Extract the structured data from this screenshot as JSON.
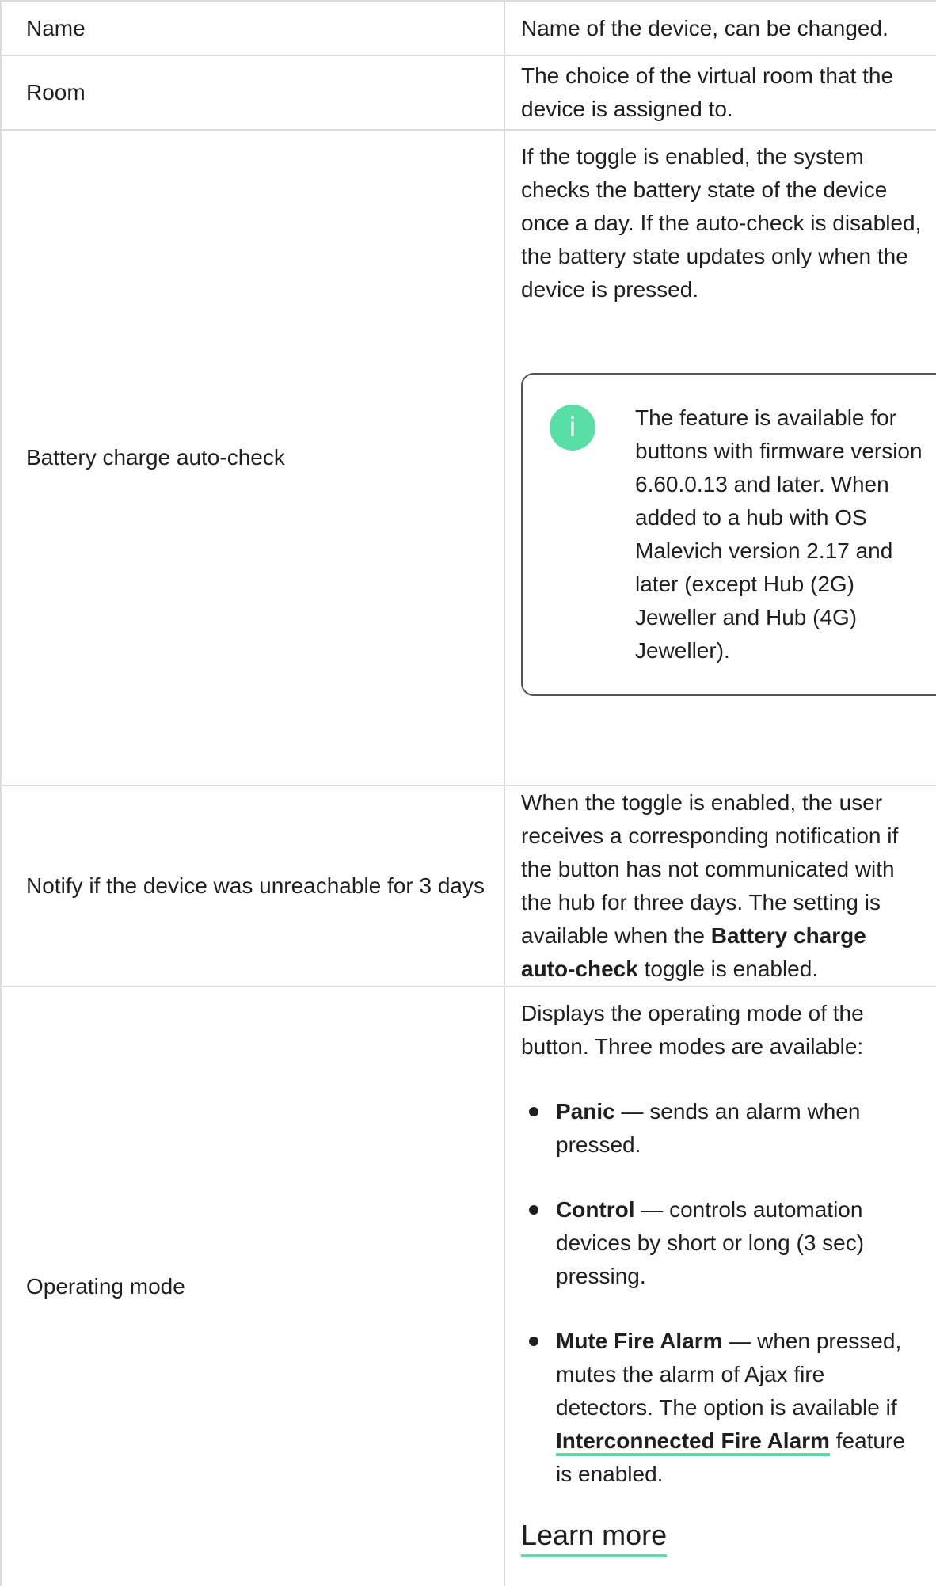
{
  "rows": [
    {
      "name": "Name",
      "desc": "Name of the device, can be changed."
    },
    {
      "name": "Room",
      "desc": "The choice of the virtual room that the device is assigned to."
    },
    {
      "name": "Battery charge auto-check",
      "desc": "If the toggle is enabled, the system checks the battery state of the device once a day. If the auto-check is disabled, the battery state updates only when the device is pressed.",
      "note": "The feature is available for buttons with firmware version 6.60.0.13 and later. When added to a hub with OS Malevich version 2.17 and later (except Hub (2G) Jeweller and Hub (4G) Jeweller).",
      "note_icon": "info-icon",
      "note_icon_glyph": "i",
      "accent_color": "#59dfa5"
    },
    {
      "name": "Notify if the device was unreachable for 3 days",
      "desc_before": "When the toggle is enabled, the user receives a corresponding notification if the button has not communicated with the hub for three days. The setting is available when the ",
      "desc_bold": "Battery charge auto-check",
      "desc_after": " toggle is enabled."
    },
    {
      "name": "Operating mode",
      "desc": "Displays the operating mode of the button. Three modes are available:",
      "modes": [
        {
          "title": "Panic",
          "text": " — sends an alarm when pressed."
        },
        {
          "title": "Control",
          "text": " — controls automation devices by short or long (3 sec) pressing."
        },
        {
          "title": "Mute Fire Alarm",
          "text": " — when pressed, mutes the alarm of Ajax fire detectors. The option is available if ",
          "link": "Interconnected Fire Alarm",
          "text_after": " feature is enabled."
        }
      ],
      "learn_more": "Learn more"
    }
  ]
}
